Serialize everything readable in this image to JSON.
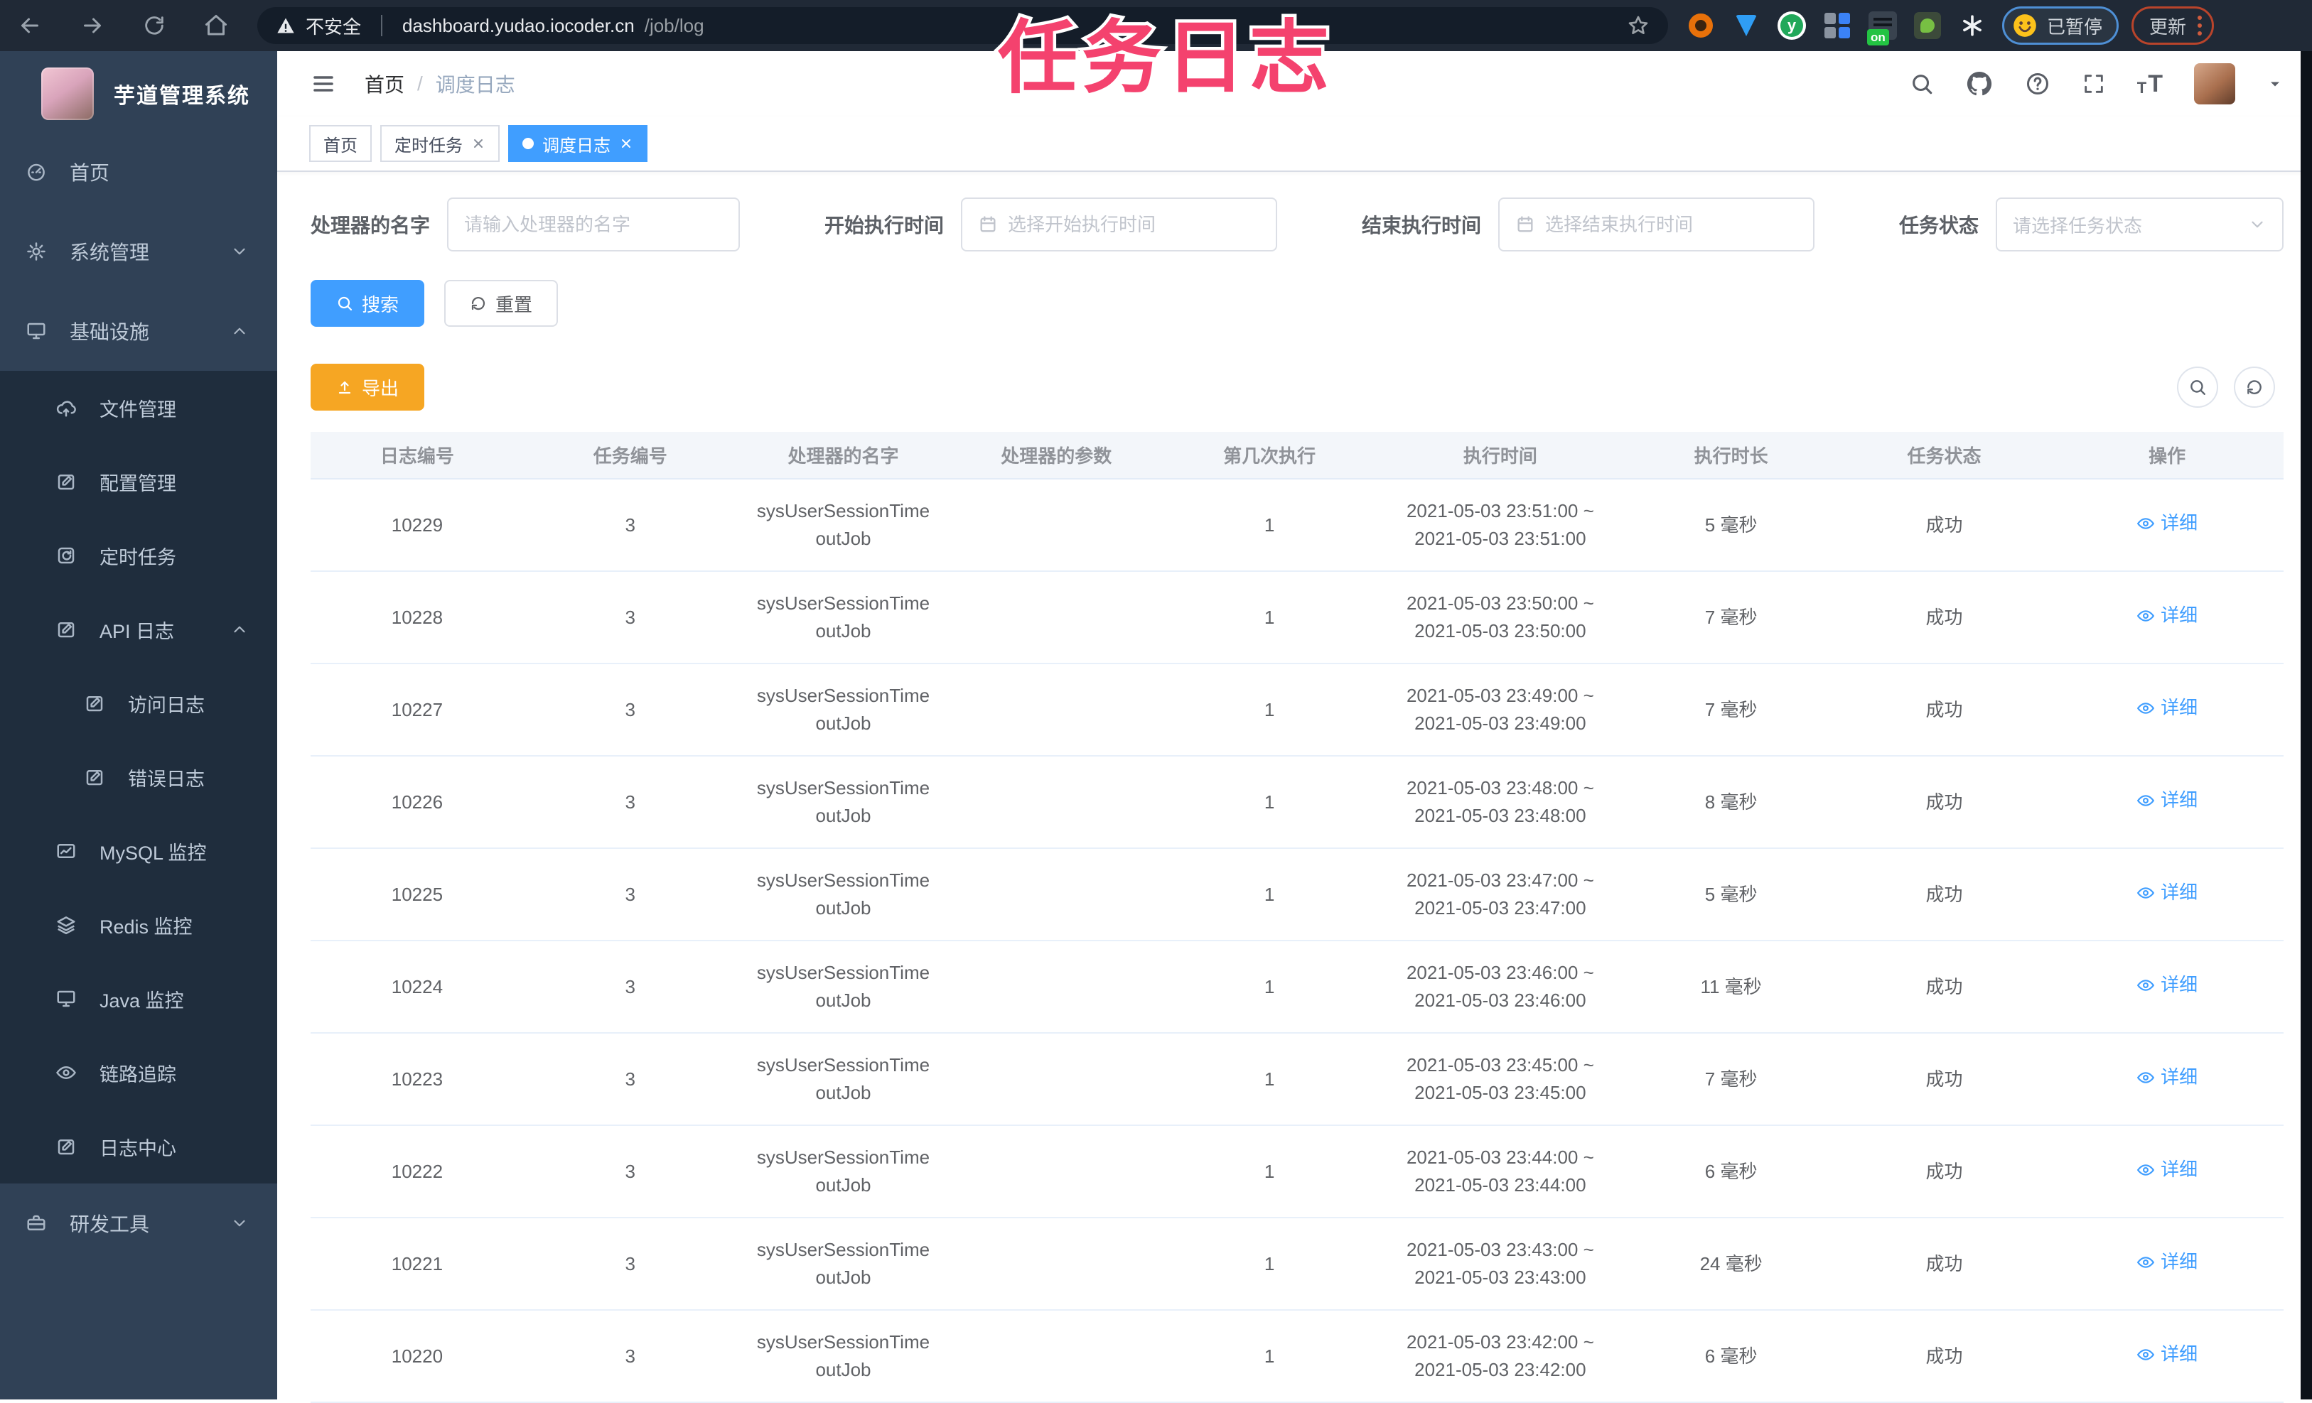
{
  "theme": {
    "primary": "#409eff",
    "warning": "#f6a623",
    "sidebar_bg": "#304156",
    "submenu_bg": "#1f2d3d",
    "overlay_pink": "#f4426e",
    "browser_bar_bg": "#202936"
  },
  "overlay_title": "任务日志",
  "browser": {
    "security_label": "不安全",
    "url_host": "dashboard.yudao.iocoder.cn",
    "url_path": "/job/log",
    "extension_on_badge": "on",
    "extension_letter": "y",
    "paused_badge": "已暂停",
    "update_button": "更新"
  },
  "sidebar": {
    "logo_title": "芋道管理系统",
    "items": [
      {
        "label": "首页"
      },
      {
        "label": "系统管理"
      },
      {
        "label": "基础设施"
      },
      {
        "label": "文件管理"
      },
      {
        "label": "配置管理"
      },
      {
        "label": "定时任务"
      },
      {
        "label": "API 日志"
      },
      {
        "label": "访问日志"
      },
      {
        "label": "错误日志"
      },
      {
        "label": "MySQL 监控"
      },
      {
        "label": "Redis 监控"
      },
      {
        "label": "Java 监控"
      },
      {
        "label": "链路追踪"
      },
      {
        "label": "日志中心"
      },
      {
        "label": "研发工具"
      }
    ]
  },
  "header": {
    "breadcrumb": {
      "items": [
        "首页",
        "调度日志"
      ],
      "separator": "/"
    }
  },
  "tabs": {
    "items": [
      {
        "label": "首页"
      },
      {
        "label": "定时任务"
      },
      {
        "label": "调度日志"
      }
    ]
  },
  "filters": {
    "handler_name": {
      "label": "处理器的名字",
      "placeholder": "请输入处理器的名字"
    },
    "begin_time": {
      "label": "开始执行时间",
      "placeholder": "选择开始执行时间"
    },
    "end_time": {
      "label": "结束执行时间",
      "placeholder": "选择结束执行时间"
    },
    "job_status": {
      "label": "任务状态",
      "placeholder": "请选择任务状态"
    }
  },
  "actions": {
    "search": "搜索",
    "reset": "重置",
    "export": "导出"
  },
  "table": {
    "columns": [
      "日志编号",
      "任务编号",
      "处理器的名字",
      "处理器的参数",
      "第几次执行",
      "执行时间",
      "执行时长",
      "任务状态",
      "操作"
    ],
    "rows": [
      {
        "id": "10229",
        "job_id": "3",
        "handler": "sysUserSessionTimeoutJob",
        "param": "",
        "times": "1",
        "period": "2021-05-03 23:51:00 ~ 2021-05-03 23:51:00",
        "duration": "5 毫秒",
        "status": "成功",
        "detail": "详细"
      },
      {
        "id": "10228",
        "job_id": "3",
        "handler": "sysUserSessionTimeoutJob",
        "param": "",
        "times": "1",
        "period": "2021-05-03 23:50:00 ~ 2021-05-03 23:50:00",
        "duration": "7 毫秒",
        "status": "成功",
        "detail": "详细"
      },
      {
        "id": "10227",
        "job_id": "3",
        "handler": "sysUserSessionTimeoutJob",
        "param": "",
        "times": "1",
        "period": "2021-05-03 23:49:00 ~ 2021-05-03 23:49:00",
        "duration": "7 毫秒",
        "status": "成功",
        "detail": "详细"
      },
      {
        "id": "10226",
        "job_id": "3",
        "handler": "sysUserSessionTimeoutJob",
        "param": "",
        "times": "1",
        "period": "2021-05-03 23:48:00 ~ 2021-05-03 23:48:00",
        "duration": "8 毫秒",
        "status": "成功",
        "detail": "详细"
      },
      {
        "id": "10225",
        "job_id": "3",
        "handler": "sysUserSessionTimeoutJob",
        "param": "",
        "times": "1",
        "period": "2021-05-03 23:47:00 ~ 2021-05-03 23:47:00",
        "duration": "5 毫秒",
        "status": "成功",
        "detail": "详细"
      },
      {
        "id": "10224",
        "job_id": "3",
        "handler": "sysUserSessionTimeoutJob",
        "param": "",
        "times": "1",
        "period": "2021-05-03 23:46:00 ~ 2021-05-03 23:46:00",
        "duration": "11 毫秒",
        "status": "成功",
        "detail": "详细"
      },
      {
        "id": "10223",
        "job_id": "3",
        "handler": "sysUserSessionTimeoutJob",
        "param": "",
        "times": "1",
        "period": "2021-05-03 23:45:00 ~ 2021-05-03 23:45:00",
        "duration": "7 毫秒",
        "status": "成功",
        "detail": "详细"
      },
      {
        "id": "10222",
        "job_id": "3",
        "handler": "sysUserSessionTimeoutJob",
        "param": "",
        "times": "1",
        "period": "2021-05-03 23:44:00 ~ 2021-05-03 23:44:00",
        "duration": "6 毫秒",
        "status": "成功",
        "detail": "详细"
      },
      {
        "id": "10221",
        "job_id": "3",
        "handler": "sysUserSessionTimeoutJob",
        "param": "",
        "times": "1",
        "period": "2021-05-03 23:43:00 ~ 2021-05-03 23:43:00",
        "duration": "24 毫秒",
        "status": "成功",
        "detail": "详细"
      },
      {
        "id": "10220",
        "job_id": "3",
        "handler": "sysUserSessionTimeoutJob",
        "param": "",
        "times": "1",
        "period": "2021-05-03 23:42:00 ~ 2021-05-03 23:42:00",
        "duration": "6 毫秒",
        "status": "成功",
        "detail": "详细"
      }
    ]
  }
}
